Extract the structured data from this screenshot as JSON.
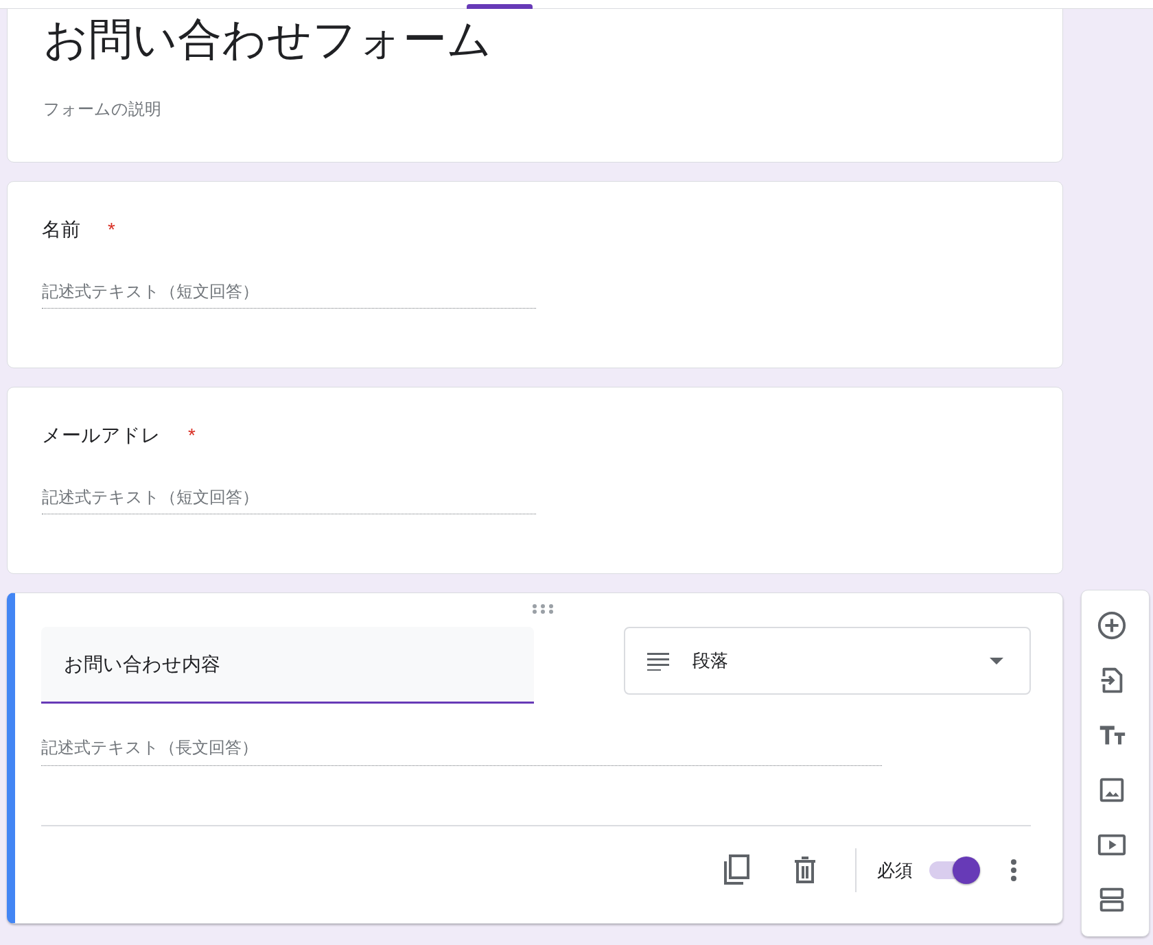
{
  "form": {
    "title": "お問い合わせフォーム",
    "description": "フォームの説明"
  },
  "questions": [
    {
      "title": "名前",
      "required": true,
      "required_mark": "*",
      "selected": false,
      "kind": "short",
      "placeholder": "記述式テキスト（短文回答）"
    },
    {
      "title": "メールアドレ",
      "required": true,
      "required_mark": "*",
      "selected": false,
      "kind": "short",
      "placeholder": "記述式テキスト（短文回答）"
    },
    {
      "title": "お問い合わせ内容",
      "required": true,
      "selected": true,
      "kind": "paragraph",
      "placeholder": "記述式テキスト（長文回答）",
      "type_label": "段落",
      "required_label": "必須"
    }
  ]
}
